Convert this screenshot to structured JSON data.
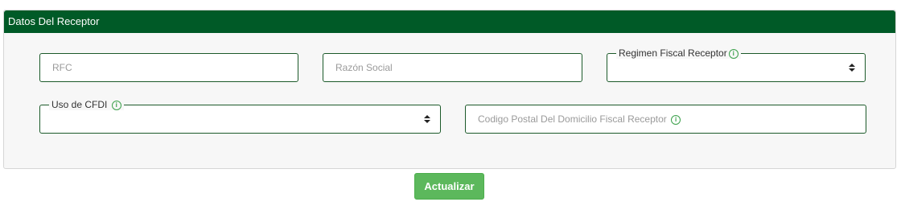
{
  "panel": {
    "title": "Datos Del Receptor"
  },
  "fields": {
    "rfc": {
      "placeholder": "RFC"
    },
    "razon_social": {
      "placeholder": "Razón Social"
    },
    "regimen_fiscal": {
      "label": "Regimen Fiscal Receptor",
      "value": ""
    },
    "uso_cfdi": {
      "label": "Uso de CFDI",
      "value": ""
    },
    "codigo_postal": {
      "placeholder": "Codigo Postal Del Domicilio Fiscal Receptor"
    }
  },
  "info_icon_glyph": "i",
  "actions": {
    "update_label": "Actualizar"
  },
  "colors": {
    "header": "#005a27",
    "border": "#1c5a2a",
    "button": "#5cb85c",
    "info_icon": "#3aa04a"
  }
}
